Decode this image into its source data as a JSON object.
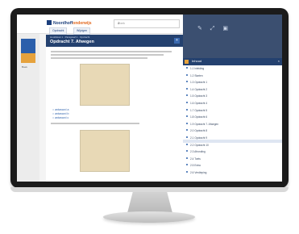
{
  "header": {
    "logo_main": "Noordhoff",
    "logo_accent": "onderwijs",
    "search_placeholder": "Zoek",
    "search_icon": "⌕",
    "buttons": [
      "Opdracht",
      "Wijzigen"
    ]
  },
  "rightbar": {
    "icons": "✎  ⤢ ▣"
  },
  "book": {
    "label": "Boek"
  },
  "content": {
    "breadcrumb": "Hoofdstuk 1 · Paragraaf 1 · Opdracht",
    "title": "Opdracht 7. Afwegen",
    "action_icon": "+",
    "options": [
      "○ antwoord a",
      "○ antwoord b",
      "○ antwoord c"
    ]
  },
  "toc": {
    "title": "Inhoud",
    "close": "×",
    "items": [
      "1.1 Inleiding",
      "1.2 Starten",
      "1.3 Opdracht 1",
      "1.4 Opdracht 2",
      "1.5 Opdracht 3",
      "1.6 Opdracht 4",
      "1.7 Opdracht 5",
      "1.8 Opdracht 6",
      "1.9 Opdracht 7. Afwegen",
      "2.0 Opdracht 8",
      "2.1 Opdracht 9",
      "2.2 Opdracht 10",
      "2.3 Afronding",
      "2.4 Toets",
      "2.5 Extra",
      "2.6 Verdieping"
    ]
  }
}
